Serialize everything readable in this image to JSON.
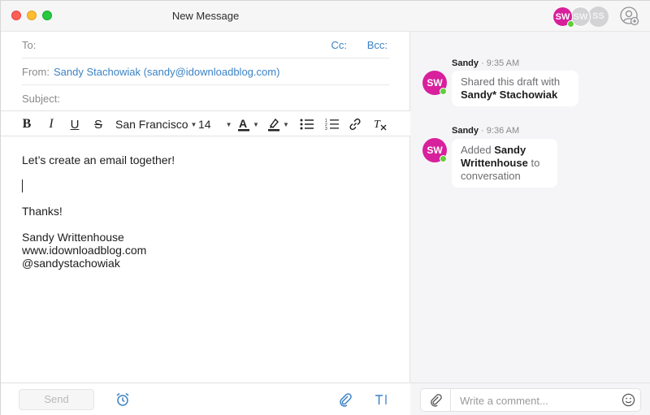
{
  "window": {
    "title": "New Message"
  },
  "header": {
    "to_label": "To:",
    "cc_label": "Cc:",
    "bcc_label": "Bcc:",
    "from_label": "From:",
    "from_value": "Sandy Stachowiak (sandy@idownloadblog.com)",
    "subject_label": "Subject:"
  },
  "toolbar": {
    "font_name": "San Francisco",
    "font_size": "14",
    "icons": [
      "bold-icon",
      "italic-icon",
      "underline-icon",
      "strikethrough-icon",
      "text-color-icon",
      "highlight-icon",
      "bulleted-list-icon",
      "numbered-list-icon",
      "link-icon",
      "clear-format-icon"
    ]
  },
  "body": {
    "line1": "Let’s create an email together!",
    "line2": "Thanks!",
    "sig1": "Sandy Writtenhouse",
    "sig2": "www.idownloadblog.com",
    "sig3": "@sandystachowiak"
  },
  "footer": {
    "send_label": "Send",
    "icons": [
      "alarm-clock-icon",
      "paperclip-icon",
      "text-format-icon"
    ]
  },
  "collaborators": [
    {
      "initials": "SW",
      "color": "#d8209d",
      "online": true
    },
    {
      "initials": "SW",
      "color": "#d3d3d6",
      "online": false
    },
    {
      "initials": "SS",
      "color": "#d3d3d6",
      "online": false
    }
  ],
  "messages": [
    {
      "author": "Sandy",
      "time": "9:35 AM",
      "avatar": "SW",
      "text_plain": "Shared this draft with",
      "text_bold": "Sandy* Stachowiak"
    },
    {
      "author": "Sandy",
      "time": "9:36 AM",
      "avatar": "SW",
      "text_pre": "Added",
      "text_bold": "Sandy Writtenhouse",
      "text_mid": "to",
      "text_post": "conversation"
    }
  ],
  "comment": {
    "placeholder": "Write a comment..."
  },
  "colors": {
    "accent": "#3b82c4",
    "avatar_pink": "#d8209d",
    "online_green": "#5fcf3a"
  }
}
